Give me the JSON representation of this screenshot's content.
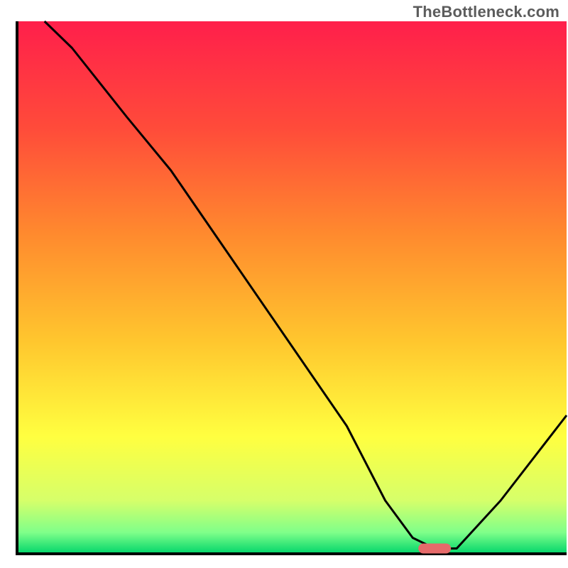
{
  "watermark": "TheBottleneck.com",
  "chart_data": {
    "type": "line",
    "title": "",
    "xlabel": "",
    "ylabel": "",
    "xlim": [
      0,
      100
    ],
    "ylim": [
      0,
      100
    ],
    "x": [
      5,
      10,
      20,
      28,
      40,
      50,
      60,
      67,
      72,
      76,
      80,
      88,
      100
    ],
    "values": [
      100,
      95,
      82,
      72,
      54,
      39,
      24,
      10,
      3,
      1,
      1,
      10,
      26
    ],
    "marker": {
      "x": 76,
      "y": 1,
      "color": "#e66a6a"
    },
    "gradient_stops": [
      {
        "pct": 0.0,
        "color": "#ff1f4b"
      },
      {
        "pct": 0.2,
        "color": "#ff4b3a"
      },
      {
        "pct": 0.4,
        "color": "#ff8a2e"
      },
      {
        "pct": 0.6,
        "color": "#ffc62e"
      },
      {
        "pct": 0.78,
        "color": "#ffff40"
      },
      {
        "pct": 0.9,
        "color": "#d6ff6a"
      },
      {
        "pct": 0.96,
        "color": "#7fff8a"
      },
      {
        "pct": 1.0,
        "color": "#00d56a"
      }
    ],
    "frame_color": "#000000",
    "line_color": "#000000"
  }
}
